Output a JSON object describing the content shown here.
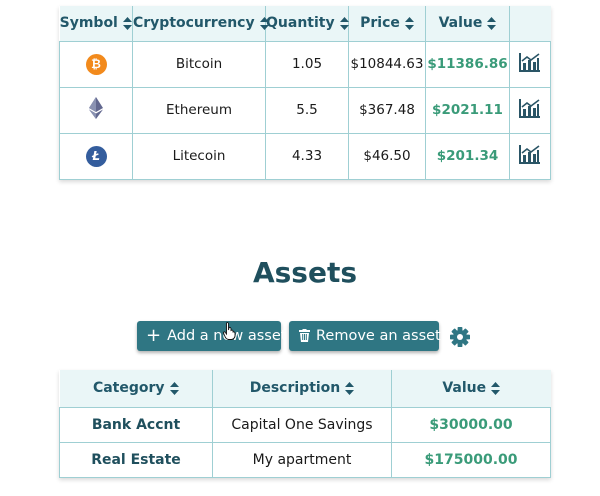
{
  "crypto_table": {
    "headers": [
      "Symbol",
      "Cryptocurrency",
      "Quantity",
      "Price",
      "Value"
    ],
    "rows": [
      {
        "icon": "bitcoin-icon",
        "name": "Bitcoin",
        "quantity": "1.05",
        "price": "$10844.63",
        "value": "$11386.86",
        "chart": "chart-icon"
      },
      {
        "icon": "ethereum-icon",
        "name": "Ethereum",
        "quantity": "5.5",
        "price": "$367.48",
        "value": "$2021.11",
        "chart": "chart-icon"
      },
      {
        "icon": "litecoin-icon",
        "name": "Litecoin",
        "quantity": "4.33",
        "price": "$46.50",
        "value": "$201.34",
        "chart": "chart-icon"
      }
    ]
  },
  "assets": {
    "title": "Assets",
    "add_button": "Add a new asset",
    "remove_button": "Remove an asset",
    "settings_icon": "gear-icon",
    "headers": [
      "Category",
      "Description",
      "Value"
    ],
    "rows": [
      {
        "category": "Bank Accnt",
        "description": "Capital One Savings",
        "value": "$30000.00"
      },
      {
        "category": "Real Estate",
        "description": "My apartment",
        "value": "$175000.00"
      }
    ]
  },
  "colors": {
    "accent": "#2f7683",
    "header_text": "#22586a",
    "value_green": "#3a9b79",
    "border": "#9fcfd3",
    "header_bg": "#eaf6f7"
  }
}
